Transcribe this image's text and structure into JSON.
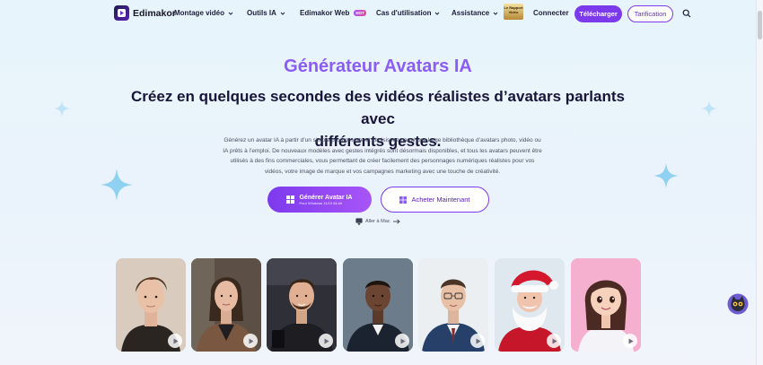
{
  "header": {
    "brand": "Edimakor",
    "nav": [
      {
        "label": "Montage vidéo"
      },
      {
        "label": "Outils IA"
      },
      {
        "label": "Edimakor Web",
        "badge": "HOT"
      },
      {
        "label": "Cas d'utilisation"
      },
      {
        "label": "Assistance"
      }
    ],
    "promo_label": "Le Rapport Vidéo",
    "connect": "Connecter",
    "download": "Télécharger",
    "pricing": "Tarification"
  },
  "hero": {
    "title": "Générateur Avatars IA",
    "subtitle_line1": "Créez en quelques secondes des vidéos réalistes d’avatars parlants avec",
    "subtitle_line2": "différents gestes.",
    "desc_1": "Générez un avatar IA à partir d’un simple prompt texte et choisissez parmi une large bibliothèque d’avatars photo, vidéo ou",
    "desc_2": "IA prêts à l’emploi. De nouveaux modèles avec gestes intégrés sont désormais disponibles, et tous les avatars peuvent être",
    "desc_3": "utilisés à des fins commerciales, vous permettant de créer facilement des personnages numériques réalistes pour vos",
    "desc_4": "vidéos, votre image de marque et vos campagnes marketing avec une touche de créativité.",
    "cta_primary": "Générer Avatar IA",
    "cta_primary_sub": "Pour Windows 11/10 64-bit",
    "cta_secondary": "Acheter Maintenant",
    "mac_link": "Aller à Mac"
  },
  "avatars": [
    {
      "name": "young-man",
      "bg": "#d9cbbd"
    },
    {
      "name": "woman-blazer",
      "bg": "#4a4038"
    },
    {
      "name": "man-studio",
      "bg": "#3a3a44"
    },
    {
      "name": "man-suit",
      "bg": "#5b6a79"
    },
    {
      "name": "man-glasses",
      "bg": "#eef0f2"
    },
    {
      "name": "santa",
      "bg": "#e8eef4"
    },
    {
      "name": "cartoon-girl",
      "bg": "#f3a6c8"
    }
  ],
  "colors": {
    "accent": "#7c3aed",
    "title": "#8b5cf6",
    "text": "#16163a"
  }
}
